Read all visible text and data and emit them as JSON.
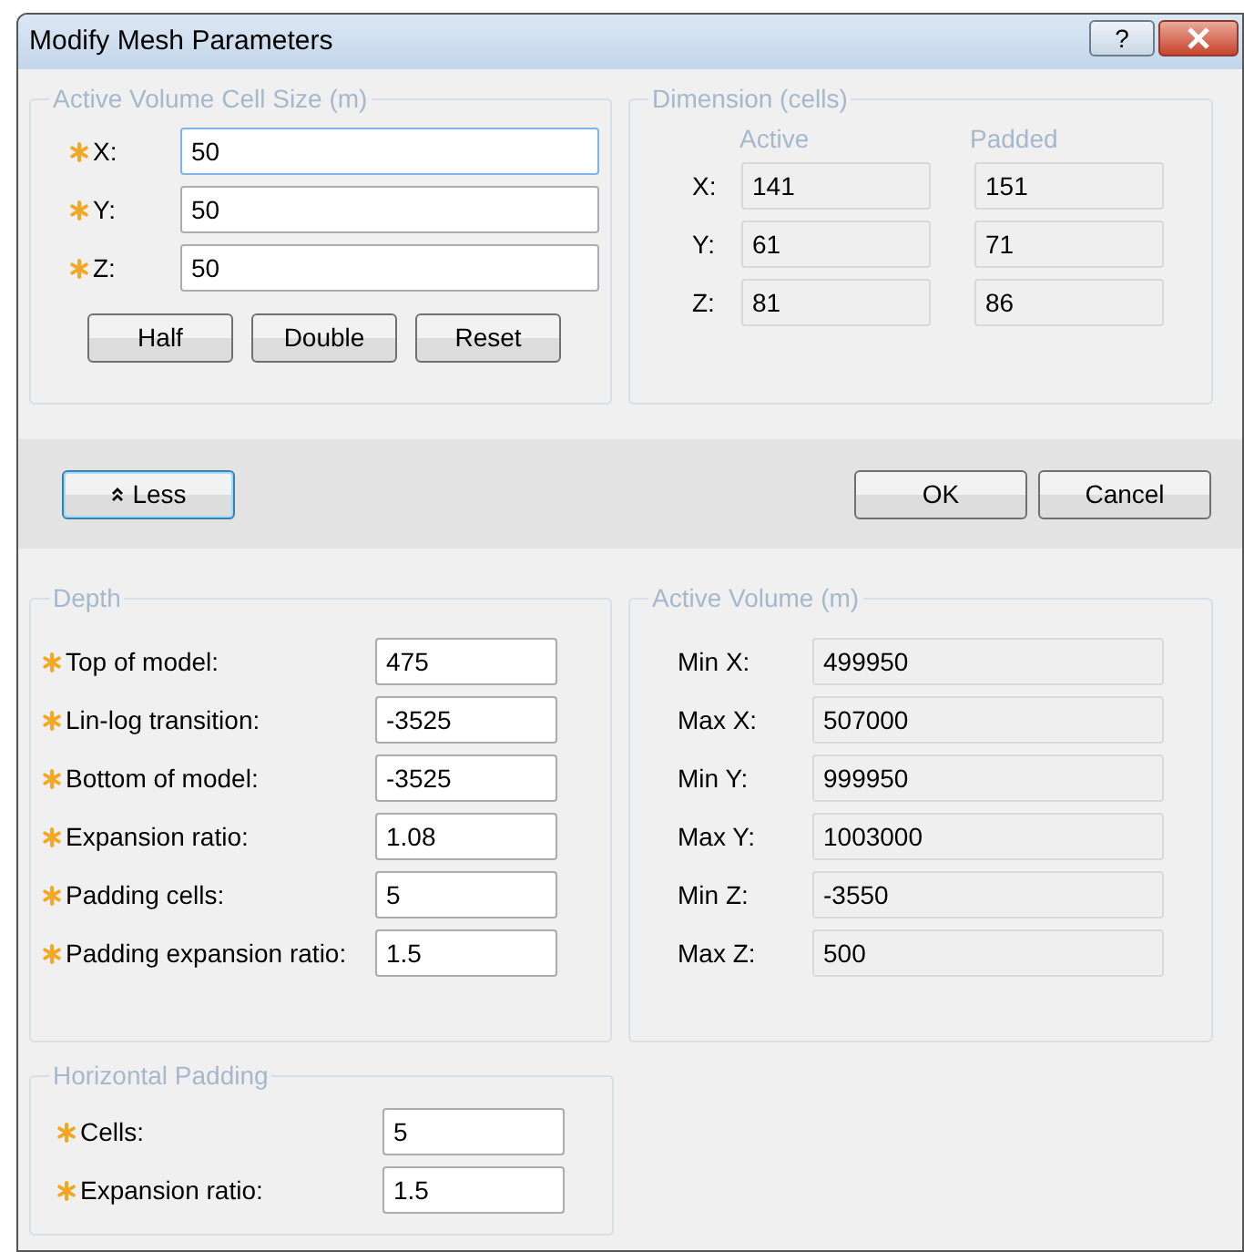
{
  "window": {
    "title": "Modify Mesh Parameters",
    "help_button": "?"
  },
  "cell_size": {
    "legend": "Active Volume Cell Size (m)",
    "fields": [
      {
        "label": "X:",
        "value": "50",
        "required": true,
        "focused": true
      },
      {
        "label": "Y:",
        "value": "50",
        "required": true,
        "focused": false
      },
      {
        "label": "Z:",
        "value": "50",
        "required": true,
        "focused": false
      }
    ],
    "buttons": [
      "Half",
      "Double",
      "Reset"
    ]
  },
  "dimension": {
    "legend": "Dimension (cells)",
    "columns": [
      "Active",
      "Padded"
    ],
    "rows": [
      {
        "label": "X:",
        "active": "141",
        "padded": "151"
      },
      {
        "label": "Y:",
        "active": "61",
        "padded": "71"
      },
      {
        "label": "Z:",
        "active": "81",
        "padded": "86"
      }
    ]
  },
  "less_button": {
    "label": "Less",
    "focused": true
  },
  "dialog_buttons": [
    "OK",
    "Cancel"
  ],
  "depth": {
    "legend": "Depth",
    "fields": [
      {
        "label": "Top of model:",
        "value": "475",
        "required": true
      },
      {
        "label": "Lin-log transition:",
        "value": "-3525",
        "required": true
      },
      {
        "label": "Bottom of model:",
        "value": "-3525",
        "required": true
      },
      {
        "label": "Expansion ratio:",
        "value": "1.08",
        "required": true
      },
      {
        "label": "Padding cells:",
        "value": "5",
        "required": true
      },
      {
        "label": "Padding expansion ratio:",
        "value": "1.5",
        "required": true
      }
    ]
  },
  "active_volume": {
    "legend": "Active Volume (m)",
    "fields": [
      {
        "label": "Min X:",
        "value": "499950"
      },
      {
        "label": "Max X:",
        "value": "507000"
      },
      {
        "label": "Min Y:",
        "value": "999950"
      },
      {
        "label": "Max Y:",
        "value": "1003000"
      },
      {
        "label": "Min Z:",
        "value": "-3550"
      },
      {
        "label": "Max Z:",
        "value": "500"
      }
    ]
  },
  "horizontal_padding": {
    "legend": "Horizontal Padding",
    "fields": [
      {
        "label": "Cells:",
        "value": "5",
        "required": true
      },
      {
        "label": "Expansion ratio:",
        "value": "1.5",
        "required": true
      }
    ]
  }
}
